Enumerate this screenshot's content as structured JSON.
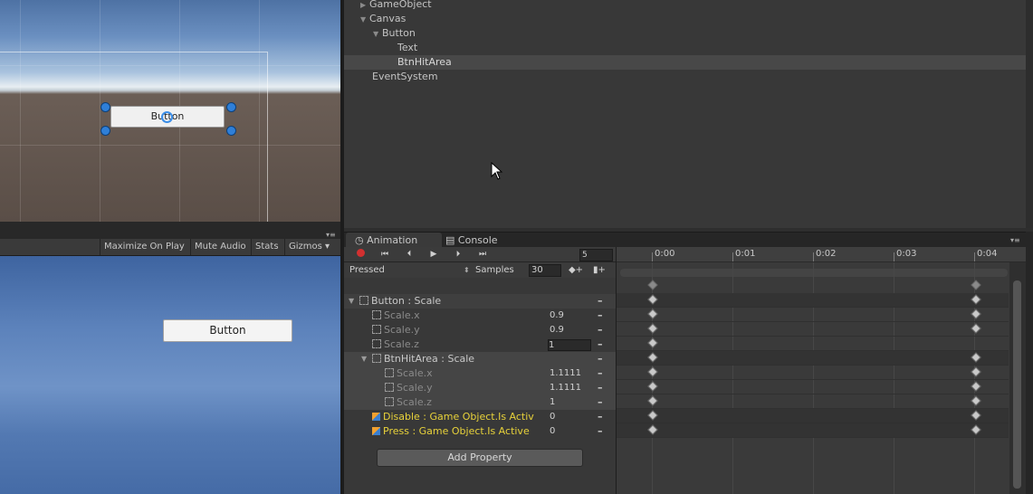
{
  "scene": {
    "button_label": "Button"
  },
  "game_toolbar": {
    "maximize": "Maximize On Play",
    "mute": "Mute Audio",
    "stats": "Stats",
    "gizmos": "Gizmos"
  },
  "game": {
    "button_label": "Button"
  },
  "hierarchy": {
    "items": [
      {
        "label": "GameObject",
        "expand": "▶"
      },
      {
        "label": "Canvas",
        "expand": "▼"
      },
      {
        "label": "Button",
        "expand": "▼"
      },
      {
        "label": "Text"
      },
      {
        "label": "BtnHitArea"
      },
      {
        "label": "EventSystem"
      }
    ]
  },
  "tabs": {
    "animation": "Animation",
    "console": "Console"
  },
  "anim_toolbar": {
    "frame": "5",
    "clip": "Pressed",
    "samples_label": "Samples",
    "samples_value": "30"
  },
  "properties": {
    "button_group": "Button : Scale",
    "button_scale_x": "Scale.x",
    "button_scale_x_val": "0.9",
    "button_scale_y": "Scale.y",
    "button_scale_y_val": "0.9",
    "button_scale_z": "Scale.z",
    "button_scale_z_val": "1",
    "hit_group": "BtnHitArea : Scale",
    "hit_scale_x": "Scale.x",
    "hit_scale_x_val": "1.1111",
    "hit_scale_y": "Scale.y",
    "hit_scale_y_val": "1.1111",
    "hit_scale_z": "Scale.z",
    "hit_scale_z_val": "1",
    "disable": "Disable : Game Object.Is Activ",
    "disable_val": "0",
    "press": "Press : Game Object.Is Active",
    "press_val": "0",
    "minus": "–",
    "add_property": "Add Property"
  },
  "timeline": {
    "ticks": [
      "0:00",
      "0:01",
      "0:02",
      "0:03",
      "0:04"
    ]
  },
  "colors": {
    "yellow_property": "#e8d23a",
    "record_red": "#d23030",
    "panel_bg": "#383838"
  }
}
